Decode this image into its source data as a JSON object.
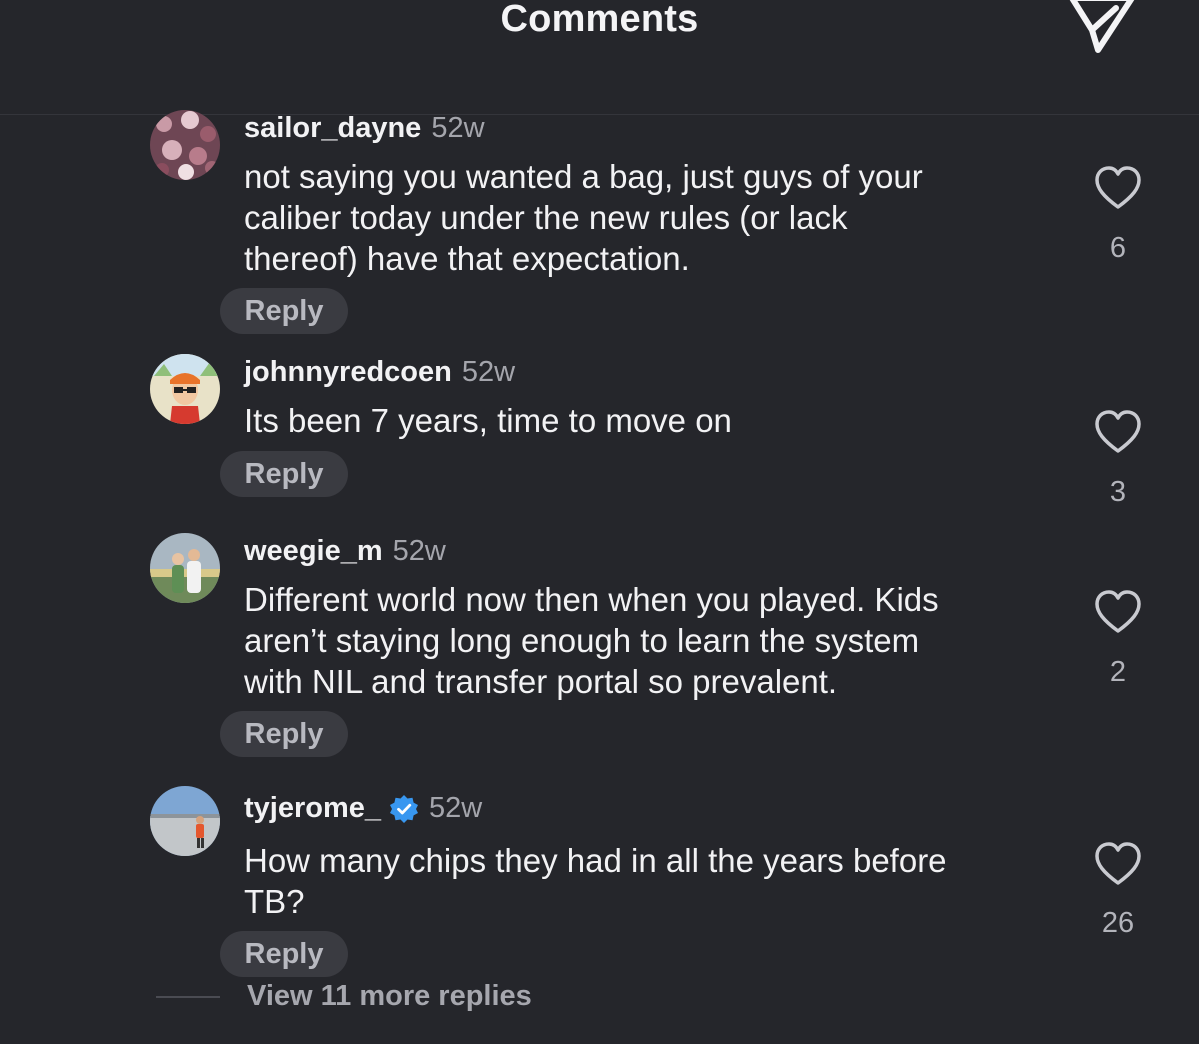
{
  "header": {
    "title": "Comments",
    "share_icon": "paper-plane-icon"
  },
  "comments": [
    {
      "username": "sailor_dayne",
      "time": "52w",
      "verified": false,
      "lines": [
        "not saying you wanted a bag, just guys of your",
        "caliber today under the new rules (or lack",
        "thereof) have that expectation."
      ],
      "reply_label": "Reply",
      "likes": "6"
    },
    {
      "username": "johnnyredcoen",
      "time": "52w",
      "verified": false,
      "lines": [
        "Its been 7 years, time to move on"
      ],
      "reply_label": "Reply",
      "likes": "3"
    },
    {
      "username": "weegie_m",
      "time": "52w",
      "verified": false,
      "lines": [
        "Different world now then when you played. Kids",
        "aren’t staying long enough to learn the system",
        "with NIL and transfer portal so prevalent."
      ],
      "reply_label": "Reply",
      "likes": "2"
    },
    {
      "username": "tyjerome_",
      "time": "52w",
      "verified": true,
      "lines": [
        "How many chips they had in all the years before",
        "TB?"
      ],
      "reply_label": "Reply",
      "likes": "26"
    }
  ],
  "view_more": {
    "label": "View 11 more replies"
  },
  "colors": {
    "background": "#25262b",
    "verified_badge": "#3897f0",
    "reply_pill": "#3a3b41"
  }
}
